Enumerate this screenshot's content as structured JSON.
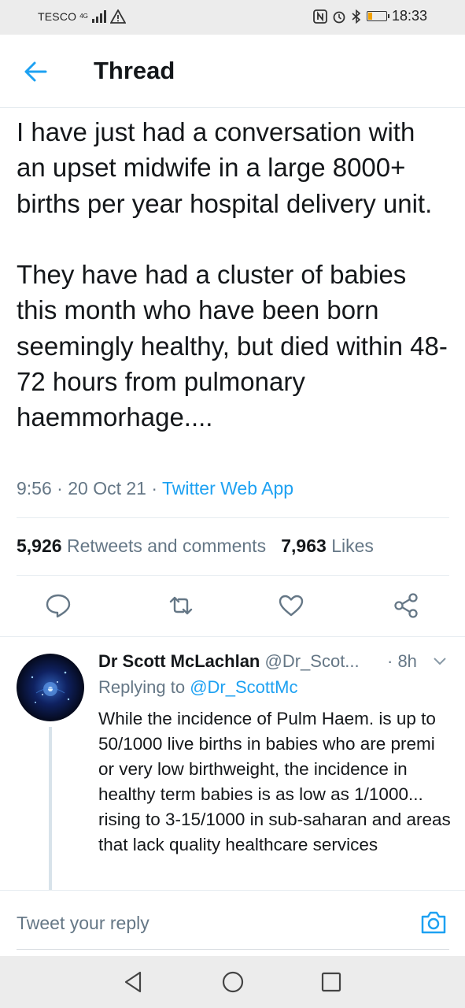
{
  "status_bar": {
    "carrier": "TESCO",
    "network": "4G",
    "time": "18:33"
  },
  "header": {
    "title": "Thread"
  },
  "tweet": {
    "text": "I have just had a conversation with an upset midwife in a large 8000+ births per year hospital delivery unit.\n\nThey have had a cluster of babies this month who have been born seemingly healthy, but died within 48-72 hours from pulmonary haemmorhage....",
    "time": "9:56",
    "sep1": "·",
    "date": "20 Oct 21",
    "sep2": "·",
    "app": "Twitter Web App",
    "retweets_count": "5,926",
    "retweets_label": "Retweets and comments",
    "likes_count": "7,963",
    "likes_label": "Likes"
  },
  "reply": {
    "name": "Dr Scott McLachlan",
    "handle": "@Dr_Scot...",
    "time": "· 8h",
    "replying_prefix": "Replying to",
    "replying_to": "@Dr_ScottMc",
    "text": "While the incidence of Pulm Haem. is up to 50/1000 live births in babies who are premi or very low birthweight, the incidence in healthy term babies is as low as 1/1000... rising to 3-15/1000 in sub-saharan and areas that lack quality healthcare services"
  },
  "compose": {
    "placeholder": "Tweet your reply"
  },
  "colors": {
    "accent": "#1da1f2",
    "secondary_text": "#657786",
    "primary_text": "#14171a"
  },
  "icons": [
    "back-arrow-icon",
    "reply-icon",
    "retweet-icon",
    "like-icon",
    "share-icon",
    "chevron-down-icon",
    "camera-icon",
    "nav-back-icon",
    "nav-home-icon",
    "nav-recents-icon"
  ]
}
